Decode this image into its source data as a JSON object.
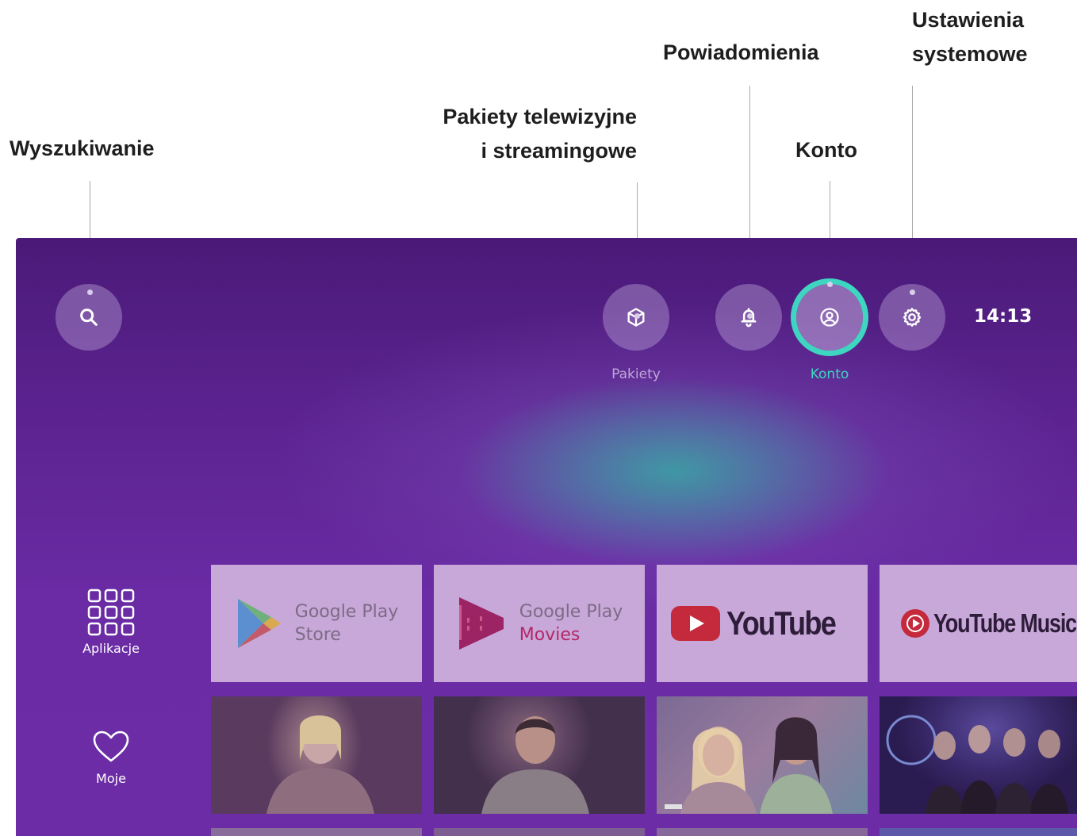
{
  "callouts": {
    "search": "Wyszukiwanie",
    "packages_line1": "Pakiety telewizyjne",
    "packages_line2": "i streamingowe",
    "notifications": "Powiadomienia",
    "account": "Konto",
    "settings_line1": "Ustawienia",
    "settings_line2": "systemowe"
  },
  "tv": {
    "clock": "14:13",
    "captions": {
      "packages": "Pakiety",
      "account": "Konto"
    },
    "icons": {
      "search": "search-icon",
      "packages": "cube-icon",
      "notifications": "bell-icon",
      "account": "user-circle-icon",
      "settings": "gear-icon",
      "apps": "grid-icon",
      "favorites": "heart-icon"
    },
    "side_nav": [
      {
        "label": "Aplikacje"
      },
      {
        "label": "Moje"
      }
    ],
    "apps": [
      {
        "line1": "Google Play",
        "line2": "Store"
      },
      {
        "line1": "Google Play",
        "line2": "Movies"
      },
      {
        "name": "YouTube"
      },
      {
        "name": "YouTube Music"
      }
    ]
  },
  "colors": {
    "focus_ring": "#3ed6c1",
    "background_purple": "#6a2ba4",
    "tile": "#c7a8d8"
  }
}
